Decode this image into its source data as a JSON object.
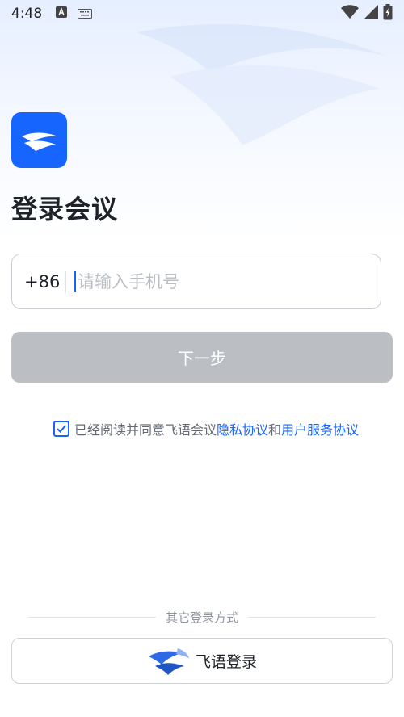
{
  "status_bar": {
    "time": "4:48"
  },
  "page": {
    "title": "登录会议"
  },
  "phone": {
    "country_code": "+86",
    "placeholder": "请输入手机号",
    "value": ""
  },
  "next_button": {
    "label": "下一步"
  },
  "agreement": {
    "checked": true,
    "prefix": "已经阅读并同意飞语会议",
    "privacy_link": "隐私协议",
    "and": "和",
    "terms_link": "用户服务协议"
  },
  "other_login": {
    "label": "其它登录方式",
    "feishu_label": "飞语登录"
  },
  "colors": {
    "brand": "#1765ff",
    "button_disabled": "#bbbfc4"
  }
}
